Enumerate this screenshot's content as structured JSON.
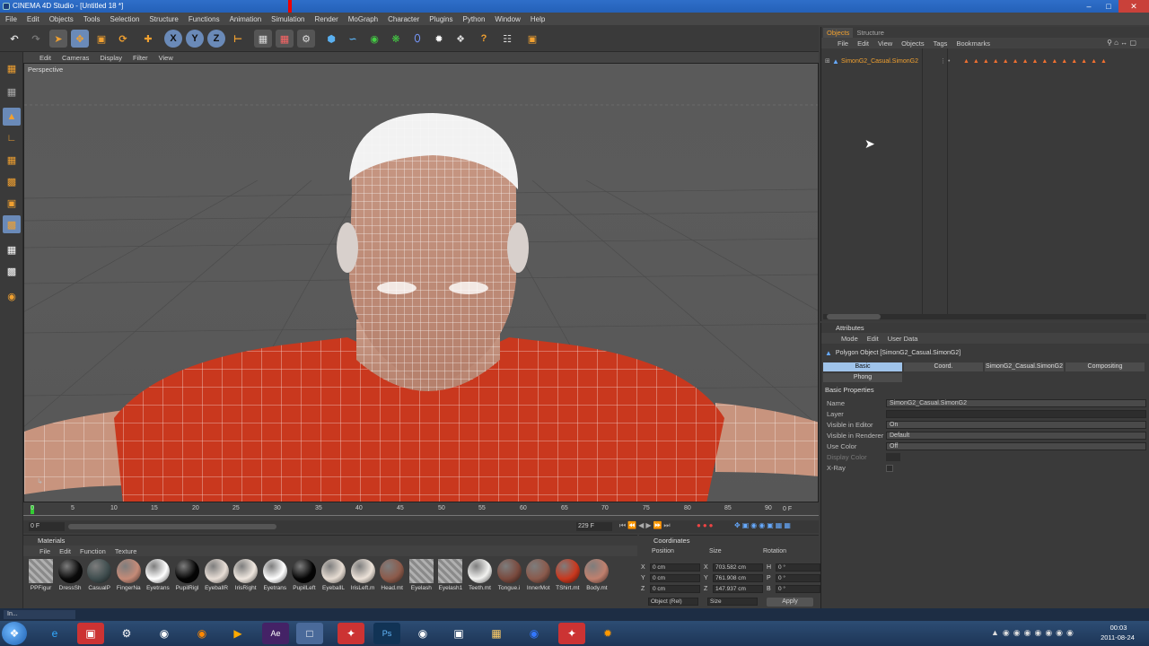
{
  "window": {
    "title": "CINEMA 4D Studio - [Untitled 18 *]"
  },
  "menu": [
    "File",
    "Edit",
    "Objects",
    "Tools",
    "Selection",
    "Structure",
    "Functions",
    "Animation",
    "Simulation",
    "Render",
    "MoGraph",
    "Character",
    "Plugins",
    "Python",
    "Window",
    "Help"
  ],
  "viewport": {
    "menu": [
      "Edit",
      "Cameras",
      "Display",
      "Filter",
      "View"
    ],
    "label": "Perspective"
  },
  "timeline": {
    "ticks": [
      "0",
      "5",
      "10",
      "15",
      "20",
      "25",
      "30",
      "35",
      "40",
      "45",
      "50",
      "55",
      "60",
      "65",
      "70",
      "75",
      "80",
      "85",
      "90"
    ],
    "end_label": "0 F",
    "start_field": "0 F",
    "range_field": "229 F"
  },
  "materials": {
    "title": "Materials",
    "menu": [
      "File",
      "Edit",
      "Function",
      "Texture"
    ],
    "items": [
      {
        "label": "PPFigur",
        "color": "#8a8a8a",
        "pattern": true
      },
      {
        "label": "DressSh",
        "color": "#0a0a0a"
      },
      {
        "label": "CasualP",
        "color": "#3f4d4e"
      },
      {
        "label": "FingerNa",
        "color": "#c58b78"
      },
      {
        "label": "Eyetrans",
        "color": "#ffffff"
      },
      {
        "label": "PupilRigl",
        "color": "#050505"
      },
      {
        "label": "EyeballR",
        "color": "#e8ded6"
      },
      {
        "label": "IrisRight",
        "color": "#efe7df"
      },
      {
        "label": "Eyetrans",
        "color": "#ffffff"
      },
      {
        "label": "PupilLeft",
        "color": "#050505"
      },
      {
        "label": "EyeballL",
        "color": "#e6dcd2"
      },
      {
        "label": "IrisLeft.m",
        "color": "#ece2d8"
      },
      {
        "label": "Head.mt",
        "color": "#8c5a4a"
      },
      {
        "label": "Eyelash",
        "color": "#8a8a8a",
        "pattern": true
      },
      {
        "label": "Eyelash1",
        "color": "#8a8a8a",
        "pattern": true
      },
      {
        "label": "Teeth.mt",
        "color": "#f2f2f0"
      },
      {
        "label": "Tongue.i",
        "color": "#7a4a3e"
      },
      {
        "label": "InnerMot",
        "color": "#8a5a4c"
      },
      {
        "label": "TShirt.mt",
        "color": "#c9381e"
      },
      {
        "label": "Body.mt",
        "color": "#c0806e"
      }
    ]
  },
  "coordinates": {
    "title": "Coordinates",
    "headers": [
      "Position",
      "Size",
      "Rotation"
    ],
    "rows": [
      {
        "axis": "X",
        "pos": "0 cm",
        "saxis": "X",
        "size": "703.582 cm",
        "raxis": "H",
        "rot": "0 °"
      },
      {
        "axis": "Y",
        "pos": "0 cm",
        "saxis": "Y",
        "size": "761.908 cm",
        "raxis": "P",
        "rot": "0 °"
      },
      {
        "axis": "Z",
        "pos": "0 cm",
        "saxis": "Z",
        "size": "147.937 cm",
        "raxis": "B",
        "rot": "0 °"
      }
    ],
    "mode": "Object (Rel)",
    "size_mode": "Size",
    "apply": "Apply"
  },
  "objects": {
    "tabs": [
      "Objects",
      "Structure"
    ],
    "menu": [
      "File",
      "Edit",
      "View",
      "Objects",
      "Tags",
      "Bookmarks"
    ],
    "items": [
      {
        "name": "SimonG2_Casual.SimonG2"
      }
    ]
  },
  "attributes": {
    "title": "Attributes",
    "menu": [
      "Mode",
      "Edit",
      "User Data"
    ],
    "object_line": "Polygon Object [SimonG2_Casual.SimonG2]",
    "tabs": [
      "Basic",
      "Coord.",
      "SimonG2_Casual.SimonG2",
      "Compositing",
      "Phong"
    ],
    "section": "Basic Properties",
    "props": [
      {
        "label": "Name",
        "value": "SimonG2_Casual.SimonG2"
      },
      {
        "label": "Layer",
        "value": ""
      },
      {
        "label": "Visible in Editor",
        "value": "On"
      },
      {
        "label": "Visible in Renderer",
        "value": "Default"
      },
      {
        "label": "Use Color",
        "value": "Off"
      },
      {
        "label": "Display Color",
        "value": ""
      },
      {
        "label": "X-Ray",
        "value": ""
      }
    ]
  },
  "taskbar": {
    "strip_label": "In...",
    "time": "00:03",
    "date": "2011-08-24"
  }
}
